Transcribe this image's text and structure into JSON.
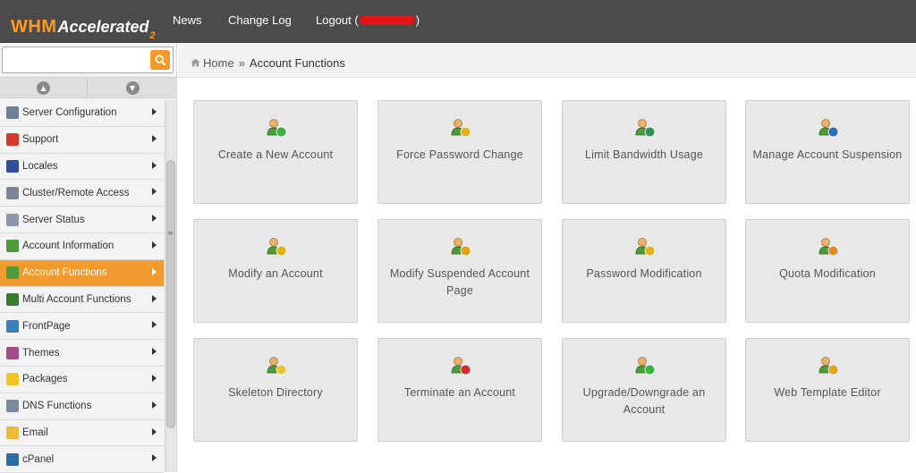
{
  "header": {
    "logo_main": "WHM",
    "logo_accent": "Accelerated",
    "logo_version": "2",
    "nav": {
      "news": "News",
      "changelog": "Change Log",
      "logout_prefix": "Logout (",
      "logout_suffix": ")"
    }
  },
  "sidebar": {
    "search": {
      "placeholder": "",
      "value": ""
    },
    "items": [
      {
        "label": "Server Configuration",
        "icon": "server-config-icon",
        "color": "#6d7f9a"
      },
      {
        "label": "Support",
        "icon": "support-icon",
        "color": "#d33a2c"
      },
      {
        "label": "Locales",
        "icon": "locales-icon",
        "color": "#2f4f9c"
      },
      {
        "label": "Cluster/Remote Access",
        "icon": "cluster-icon",
        "color": "#7d8796"
      },
      {
        "label": "Server Status",
        "icon": "server-status-icon",
        "color": "#8c96a8"
      },
      {
        "label": "Account Information",
        "icon": "account-info-icon",
        "color": "#4c9a3a"
      },
      {
        "label": "Account Functions",
        "icon": "account-functions-icon",
        "color": "#4c9a3a",
        "active": true
      },
      {
        "label": "Multi Account Functions",
        "icon": "multi-account-icon",
        "color": "#3b7d2e"
      },
      {
        "label": "FrontPage",
        "icon": "frontpage-icon",
        "color": "#3c7fb8"
      },
      {
        "label": "Themes",
        "icon": "themes-icon",
        "color": "#a44a8a"
      },
      {
        "label": "Packages",
        "icon": "packages-icon",
        "color": "#f3c623"
      },
      {
        "label": "DNS Functions",
        "icon": "dns-icon",
        "color": "#7b8aa0"
      },
      {
        "label": "Email",
        "icon": "email-icon",
        "color": "#f0b93a"
      },
      {
        "label": "cPanel",
        "icon": "cpanel-icon",
        "color": "#2f6aa0"
      }
    ]
  },
  "breadcrumb": {
    "home": "Home",
    "separator": "»",
    "current": "Account Functions"
  },
  "tiles": [
    {
      "label": "Create a New Account",
      "icon": "create-account-icon",
      "badge": "#3cb043"
    },
    {
      "label": "Force Password Change",
      "icon": "force-password-icon",
      "badge": "#e2b21c"
    },
    {
      "label": "Limit Bandwidth Usage",
      "icon": "bandwidth-icon",
      "badge": "#2f8f5a"
    },
    {
      "label": "Manage Account Suspension",
      "icon": "suspension-icon",
      "badge": "#2e6fc4"
    },
    {
      "label": "Modify an Account",
      "icon": "modify-account-icon",
      "badge": "#e2b21c"
    },
    {
      "label": "Modify Suspended Account Page",
      "icon": "suspended-page-icon",
      "badge": "#e2a21c"
    },
    {
      "label": "Password Modification",
      "icon": "password-modification-icon",
      "badge": "#e2b21c"
    },
    {
      "label": "Quota Modification",
      "icon": "quota-icon",
      "badge": "#e08a2a"
    },
    {
      "label": "Skeleton Directory",
      "icon": "skeleton-directory-icon",
      "badge": "#f0c030"
    },
    {
      "label": "Terminate an Account",
      "icon": "terminate-account-icon",
      "badge": "#d42a2a"
    },
    {
      "label": "Upgrade/Downgrade an Account",
      "icon": "upgrade-account-icon",
      "badge": "#3cb043"
    },
    {
      "label": "Web Template Editor",
      "icon": "web-template-icon",
      "badge": "#e2a21c"
    }
  ],
  "colors": {
    "topbar": "#4b4b4b",
    "accent": "#f39a2e",
    "tile_bg": "#e8e8e8"
  }
}
